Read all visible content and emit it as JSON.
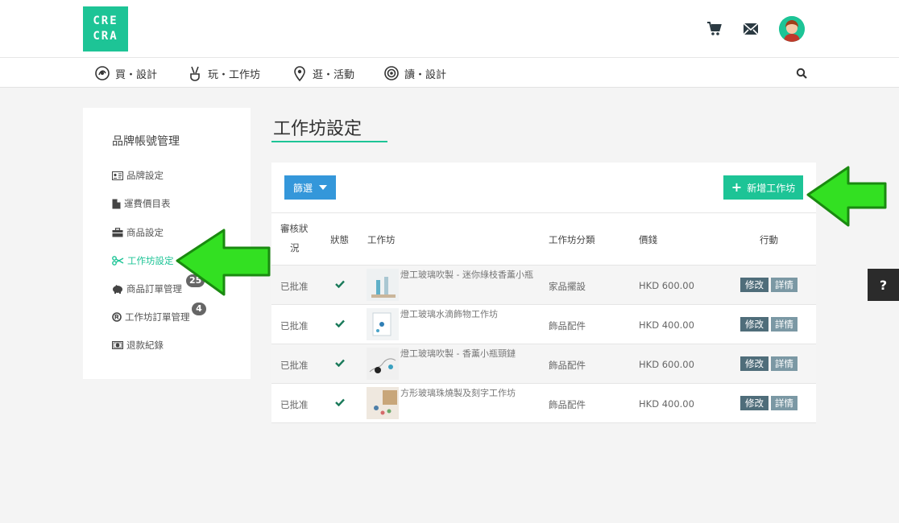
{
  "header": {
    "logo_line1": "CRE",
    "logo_line2": "CRA"
  },
  "nav": {
    "items": [
      {
        "label": "買・設計"
      },
      {
        "label": "玩・工作坊"
      },
      {
        "label": "逛・活動"
      },
      {
        "label": "讀・設計"
      }
    ]
  },
  "sidebar": {
    "title": "品牌帳號管理",
    "items": [
      {
        "label": "品牌設定"
      },
      {
        "label": "運費價目表"
      },
      {
        "label": "商品設定"
      },
      {
        "label": "工作坊設定"
      },
      {
        "label": "商品訂單管理",
        "badge": "25"
      },
      {
        "label": "工作坊訂單管理",
        "badge": "4"
      },
      {
        "label": "退款紀錄"
      }
    ]
  },
  "main": {
    "title": "工作坊設定",
    "filter_label": "篩選",
    "add_label": "新增工作坊",
    "table": {
      "headers": {
        "review_line1": "審核狀",
        "review_line2": "況",
        "status": "狀態",
        "workshop": "工作坊",
        "category": "工作坊分類",
        "price": "價錢",
        "action": "行動"
      },
      "rows": [
        {
          "review": "已批准",
          "name": "燈工玻璃吹製 - 迷你綠枝香薰小瓶",
          "category": "家品擺設",
          "price": "HKD 600.00",
          "edit": "修改",
          "detail": "詳情"
        },
        {
          "review": "已批准",
          "name": "燈工玻璃水滴飾物工作坊",
          "category": "飾品配件",
          "price": "HKD 400.00",
          "edit": "修改",
          "detail": "詳情"
        },
        {
          "review": "已批准",
          "name": "燈工玻璃吹製 - 香薰小瓶頸鏈",
          "category": "飾品配件",
          "price": "HKD 600.00",
          "edit": "修改",
          "detail": "詳情"
        },
        {
          "review": "已批准",
          "name": "方形玻璃珠燒製及刻字工作坊",
          "category": "飾品配件",
          "price": "HKD 400.00",
          "edit": "修改",
          "detail": "詳情"
        }
      ]
    }
  },
  "help_label": "?",
  "colors": {
    "brand": "#1dc496",
    "filter": "#3497da",
    "edit": "#4f6d7a",
    "detail": "#7b98a4",
    "arrow": "#22dd11"
  }
}
